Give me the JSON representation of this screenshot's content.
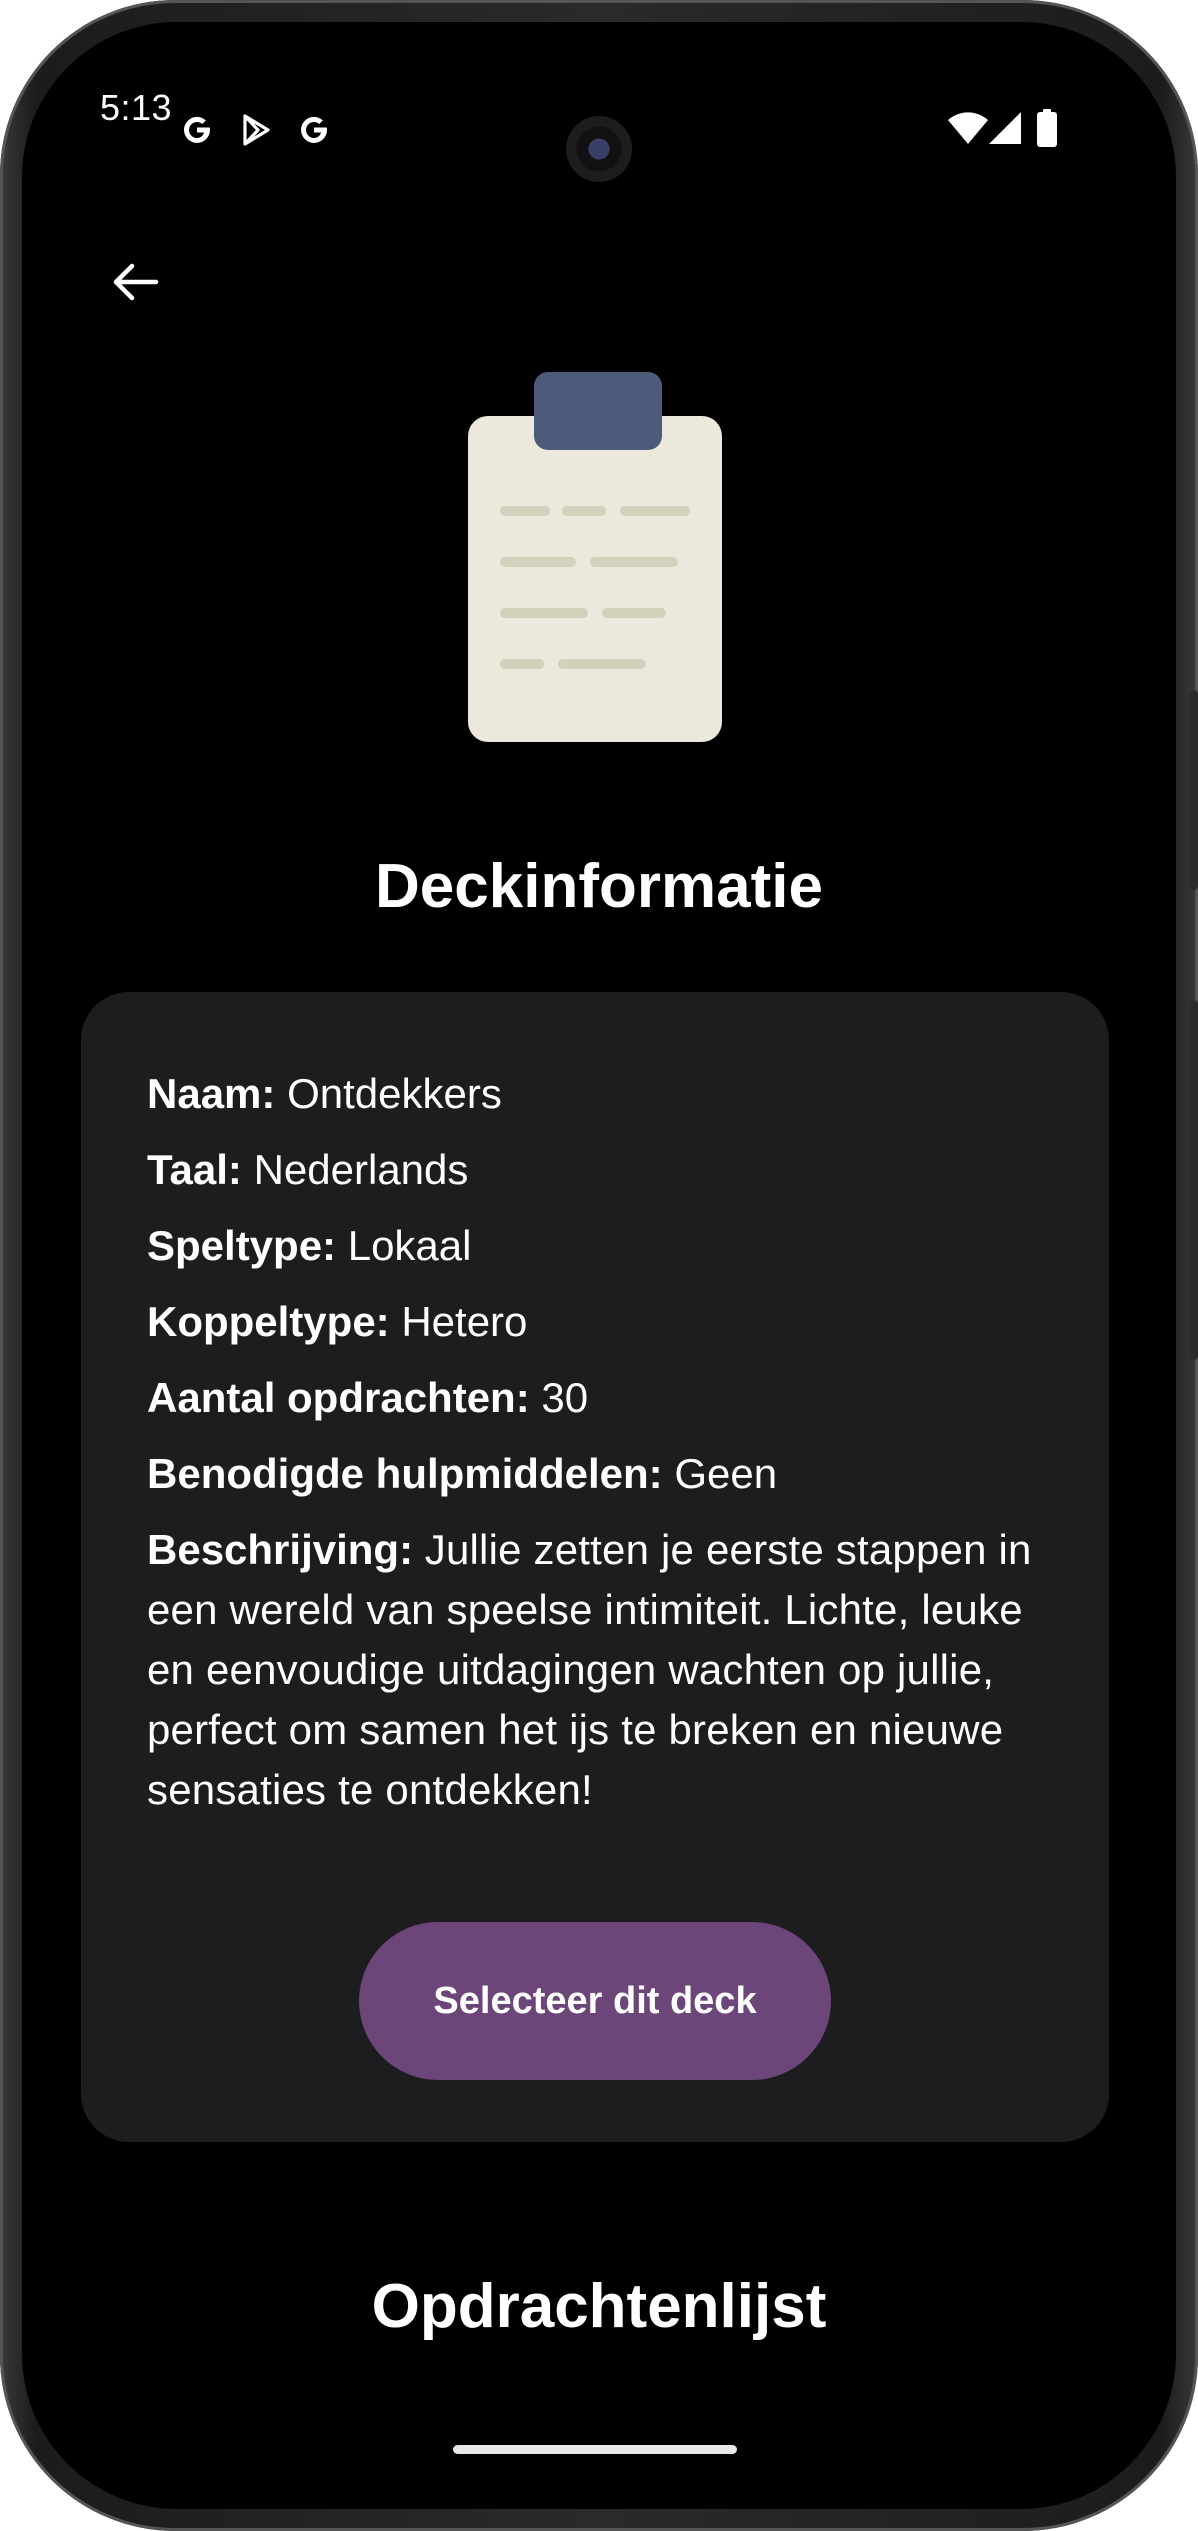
{
  "status_bar": {
    "time": "5:13",
    "left_icons": [
      "google-g-icon",
      "play-store-icon",
      "google-g-icon"
    ],
    "right_icons": [
      "wifi-icon",
      "signal-icon",
      "battery-icon"
    ]
  },
  "header": {
    "back_icon": "arrow-back-icon",
    "illustration": "clipboard-icon"
  },
  "page": {
    "title": "Deckinformatie",
    "section_title": "Opdrachtenlijst"
  },
  "deck": {
    "name_label": "Naam:",
    "name_value": "Ontdekkers",
    "language_label": "Taal:",
    "language_value": "Nederlands",
    "gametype_label": "Speltype:",
    "gametype_value": "Lokaal",
    "coupletype_label": "Koppeltype:",
    "coupletype_value": "Hetero",
    "count_label": "Aantal opdrachten:",
    "count_value": "30",
    "tools_label": "Benodigde hulpmiddelen:",
    "tools_value": "Geen",
    "description_label": "Beschrijving:",
    "description_value": "Jullie zetten je eerste stappen in een wereld van speelse intimiteit. Lichte, leuke en eenvoudige uitdagingen wachten op jullie, perfect om samen het ijs te breken en nieuwe sensaties te ontdekken!"
  },
  "actions": {
    "select_label": "Selecteer dit deck"
  },
  "colors": {
    "background": "#000000",
    "card": "#1d1d1f",
    "button": "#6c4679",
    "clipboard_board": "#ece8dc",
    "clipboard_clip": "#4e5a7a",
    "clipboard_lines": "#d3d0bc"
  }
}
